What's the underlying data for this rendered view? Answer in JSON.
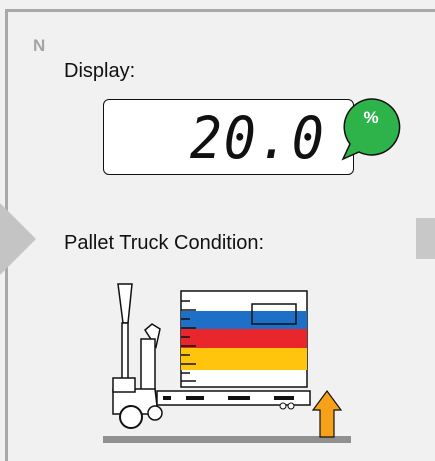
{
  "section": {
    "letter": "N"
  },
  "display": {
    "label": "Display:",
    "value": "20.0",
    "unit": "%",
    "unit_bubble_color": "#2db34a"
  },
  "truck": {
    "label": "Pallet Truck Condition:",
    "load_colors": [
      "#1e6fc6",
      "#e8262b",
      "#fec50c"
    ],
    "arrow_color": "#f7a11a",
    "icons": [
      "pallet-truck-icon",
      "lift-up-arrow-icon"
    ]
  },
  "nav": {
    "prev_icon": "chevron-left-icon",
    "next_icon": "tab-right-icon"
  }
}
